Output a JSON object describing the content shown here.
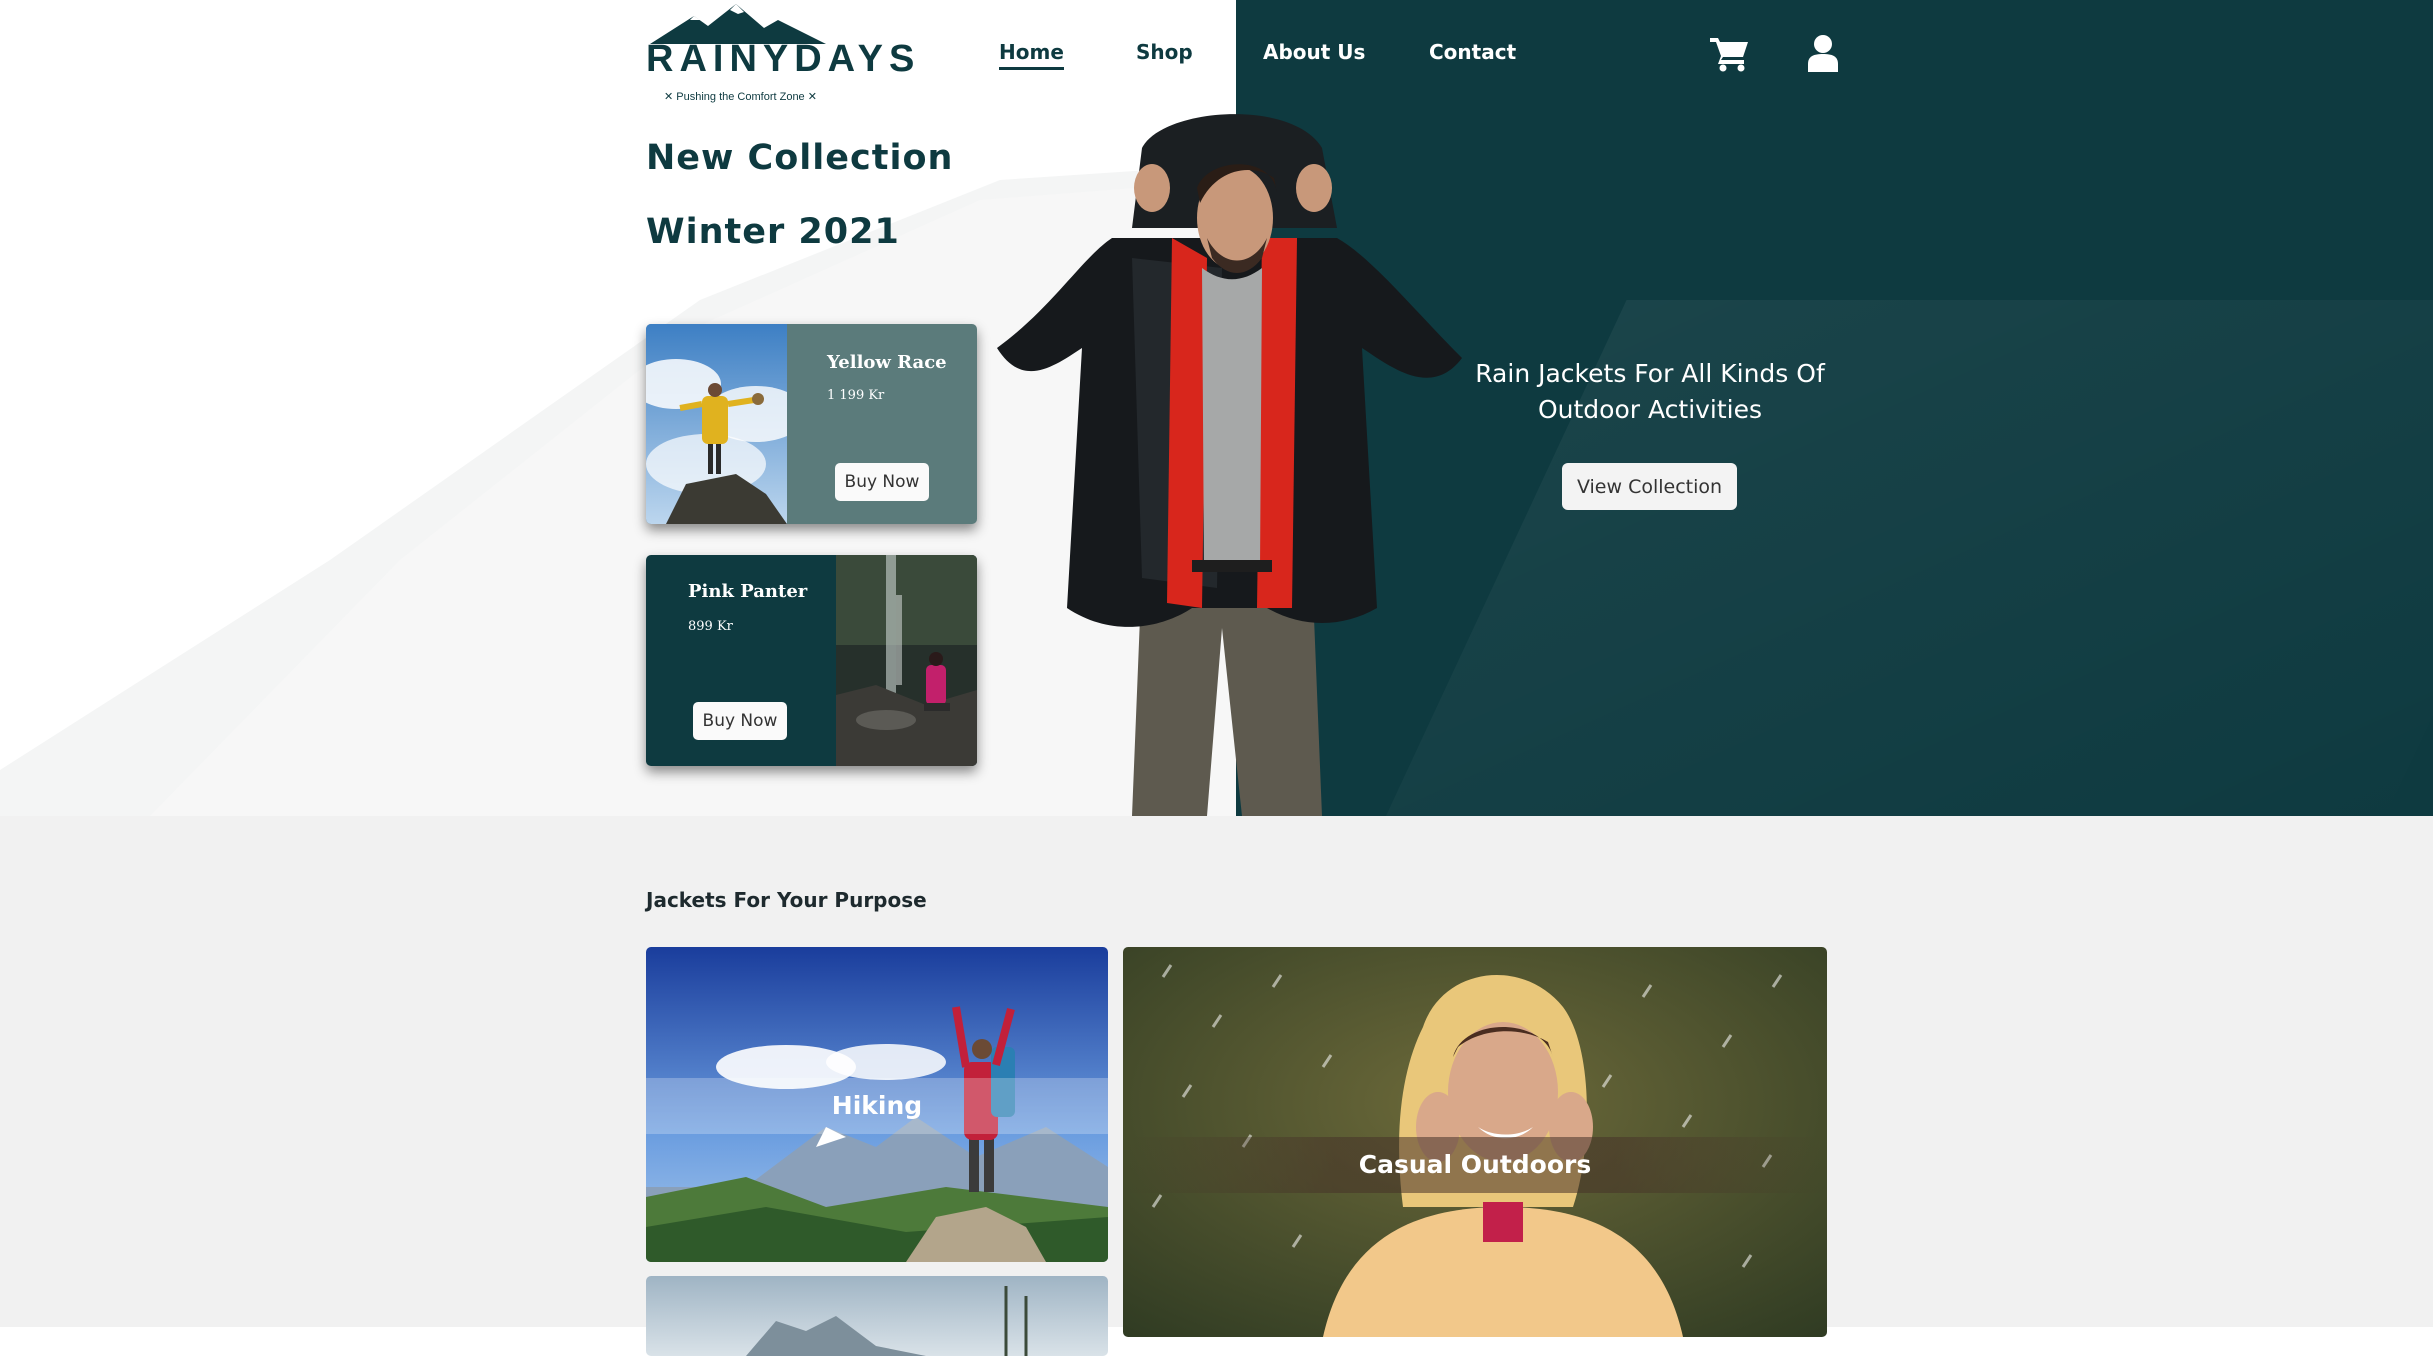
{
  "brand": {
    "name": "RAINYDAYS",
    "tagline": "✕ Pushing the Comfort Zone ✕",
    "colors": {
      "primary": "#0e3a40",
      "card_alt": "#5b7b7b",
      "section_bg": "#f1f1f1"
    }
  },
  "nav": {
    "items": [
      {
        "label": "Home",
        "active": true
      },
      {
        "label": "Shop"
      },
      {
        "label": "About Us"
      },
      {
        "label": "Contact"
      }
    ],
    "icons": [
      "shopping-cart-icon",
      "user-icon"
    ]
  },
  "hero": {
    "heading_line1": "New Collection",
    "heading_line2": "Winter 2021",
    "tagline": "Rain Jackets For All Kinds Of Outdoor Activities",
    "cta": "View Collection"
  },
  "products": [
    {
      "name": "Yellow Race",
      "price": "1 199 Kr",
      "button": "Buy Now"
    },
    {
      "name": "Pink Panter",
      "price": "899 Kr",
      "button": "Buy Now"
    }
  ],
  "purpose": {
    "title": "Jackets For Your Purpose",
    "categories": [
      {
        "label": "Hiking"
      },
      {
        "label": "Casual Outdoors"
      }
    ]
  }
}
